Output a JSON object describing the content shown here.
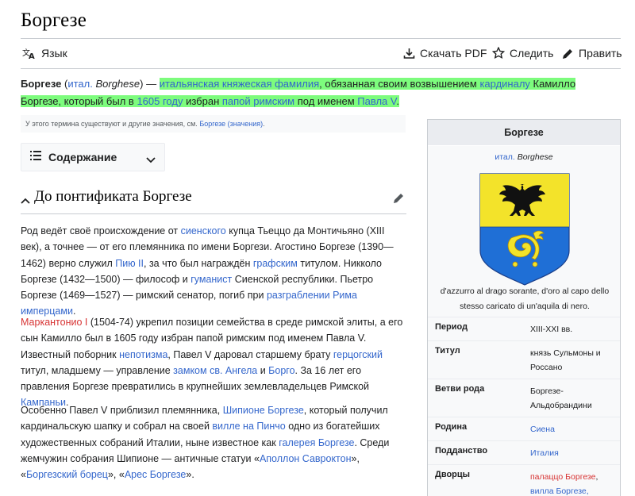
{
  "page": {
    "title": "Боргезе"
  },
  "toolbar": {
    "language": "Язык",
    "download_pdf": "Скачать PDF",
    "watch": "Следить",
    "edit": "Править"
  },
  "lead": {
    "term": "Боргезе",
    "paren_open": " (",
    "lang_abbr": "итал.",
    "native": "Borghese",
    "paren_close": ") — ",
    "h1": "итальянская княжеская фамилия",
    "h2": ", обязанная своим возвышением ",
    "h3": "кардиналу",
    "h4": " Камилло Боргезе, который был в ",
    "h5": "1605 году",
    "h6": " избран ",
    "h7": "папой римским",
    "h8": " под именем ",
    "h9": "Павла V",
    "h10": "."
  },
  "hatnote": {
    "text": "У этого термина существуют и другие значения, см. ",
    "link": "Боргезе (значения)",
    "end": "."
  },
  "toc": {
    "label": "Содержание"
  },
  "section": {
    "title": "До понтификата Боргезе"
  },
  "p1": {
    "t1": "Род ведёт своё происхождение от ",
    "l1": "сиенского",
    "t2": " купца Тьеццо да Монтичьяно (XIII век), а точнее — от его племянника по имени Боргези. Агостино Боргезе (1390—1462) верно служил ",
    "l2": "Пию II",
    "t3": ", за что был награждён ",
    "l3": "графским",
    "t4": " титулом. Никколо Боргезе (1432—1500) — философ и ",
    "l4": "гуманист",
    "t5": " Сиенской республики. Пьетро Боргезе (1469—1527) — римский сенатор, погиб при ",
    "l5": "разграблении Рима имперцами",
    "t6": "."
  },
  "p2": {
    "r1": "Маркантонио I",
    "t1": " (1504-74) укрепил позиции семейства в среде римской элиты, а его сын Камилло был в 1605 году избран папой римским под именем Павла V. Известный поборник ",
    "l1": "непотизма",
    "t2": ", Павел V даровал старшему брату ",
    "l2": "герцогский",
    "t3": " титул, младшему — управление ",
    "l3": "замком св. Ангела",
    "t4": " и ",
    "l4": "Борго",
    "t5": ". За 16 лет его правления Боргезе превратились в крупнейших землевладельцев Римской ",
    "l5": "Кампаньи",
    "t6": "."
  },
  "p3": {
    "t1": "Особенно Павел V приблизил племянника, ",
    "l1": "Шипионе Боргезе",
    "t2": ", который получил кардинальскую шапку и собрал на своей ",
    "l2": "вилле на Пинчо",
    "t3": " одно из богатейших художественных собраний Италии, ныне известное как ",
    "l3": "галерея Боргезе",
    "t4": ". Среди жемчужин собрания Шипионе — античные статуи «",
    "l4": "Аполлон Савроктон",
    "t5": "», «",
    "l5": "Боргезский борец",
    "t6": "», «",
    "l6": "Арес Боргезе",
    "t7": "»."
  },
  "infobox": {
    "title": "Боргезе",
    "lang_abbr": "итал.",
    "native": "Borghese",
    "caption": "d'azzurro al drago sorante, d'oro al capo dello stesso caricato di un'aquila di nero.",
    "coa_colors": {
      "chief": "#f3e32a",
      "base": "#1f6fd6",
      "eagle": "#111111",
      "dragon": "#f3e32a"
    },
    "rows": [
      {
        "label": "Период",
        "value": "XIII-XXI вв."
      },
      {
        "label": "Титул",
        "value": "князь Сульмоны и Россано"
      },
      {
        "label": "Ветви рода",
        "value": "Боргезе-Альдобрандини"
      },
      {
        "label": "Родина",
        "value": "Сиена"
      },
      {
        "label": "Подданство",
        "value": "Италия"
      },
      {
        "label": "Дворцы",
        "value_red": "палаццо Боргезе",
        "value_sep": ",",
        "value_link": "вилла Боргезе,"
      }
    ]
  }
}
